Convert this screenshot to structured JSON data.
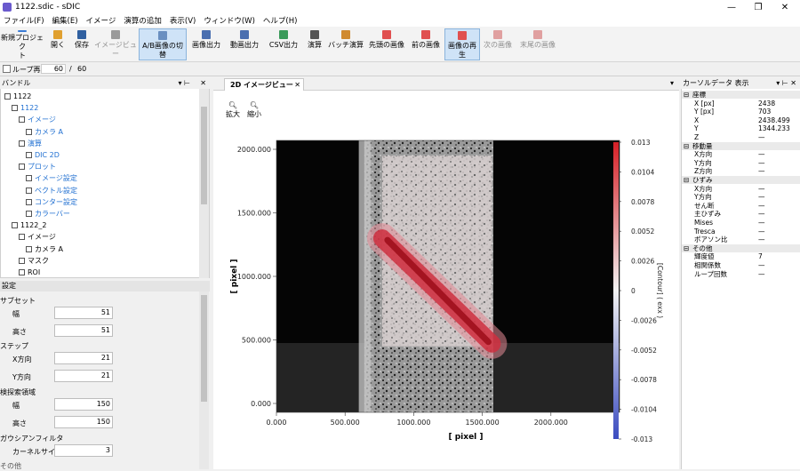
{
  "window": {
    "title": "1122.sdic - sDIC",
    "minimize": "—",
    "restore": "❐",
    "close": "✕"
  },
  "menu": [
    "ファイル(F)",
    "編集(E)",
    "イメージ",
    "演算の追加",
    "表示(V)",
    "ウィンドウ(W)",
    "ヘルプ(H)"
  ],
  "toolbar": [
    {
      "label": "新規プロジェク\nト",
      "icon": "new-file-icon",
      "state": "normal"
    },
    {
      "label": "開く",
      "icon": "open-folder-icon",
      "state": "normal"
    },
    {
      "label": "保存",
      "icon": "save-icon",
      "state": "normal"
    },
    {
      "label": "イメージビュー",
      "icon": "image-view-icon",
      "state": "disabled"
    },
    {
      "label": "A/B画像の切\n替",
      "icon": "switch-icon",
      "state": "selected"
    },
    {
      "label": "画像出力",
      "icon": "image-export-icon",
      "state": "normal"
    },
    {
      "label": "動画出力",
      "icon": "video-export-icon",
      "state": "normal"
    },
    {
      "label": "CSV出力",
      "icon": "csv-export-icon",
      "state": "normal"
    },
    {
      "label": "演算",
      "icon": "calculate-icon",
      "state": "normal"
    },
    {
      "label": "バッチ演算",
      "icon": "batch-icon",
      "state": "normal"
    },
    {
      "label": "先頭の画像",
      "icon": "first-image-icon",
      "state": "normal"
    },
    {
      "label": "前の画像",
      "icon": "previous-image-icon",
      "state": "normal"
    },
    {
      "label": "画像の再生",
      "icon": "play-icon",
      "state": "selected"
    },
    {
      "label": "次の画像",
      "icon": "next-image-icon",
      "state": "disabled"
    },
    {
      "label": "末尾の画像",
      "icon": "last-image-icon",
      "state": "disabled"
    }
  ],
  "loop": {
    "label": "ループ再",
    "current": "60",
    "sep": "/",
    "total": "60"
  },
  "bundle": {
    "title": "バンドル",
    "items": [
      {
        "label": "1122",
        "depth": 0,
        "blue": false
      },
      {
        "label": "1122",
        "depth": 1,
        "blue": true
      },
      {
        "label": "イメージ",
        "depth": 2,
        "blue": true
      },
      {
        "label": "カメラ A",
        "depth": 3,
        "blue": true
      },
      {
        "label": "演算",
        "depth": 2,
        "blue": true
      },
      {
        "label": "DIC 2D",
        "depth": 3,
        "blue": true
      },
      {
        "label": "プロット",
        "depth": 2,
        "blue": true
      },
      {
        "label": "イメージ設定",
        "depth": 3,
        "blue": true
      },
      {
        "label": "ベクトル設定",
        "depth": 3,
        "blue": true
      },
      {
        "label": "コンター設定",
        "depth": 3,
        "blue": true
      },
      {
        "label": "カラーバー",
        "depth": 3,
        "blue": true
      },
      {
        "label": "1122_2",
        "depth": 1,
        "blue": false
      },
      {
        "label": "イメージ",
        "depth": 2,
        "blue": false
      },
      {
        "label": "カメラ A",
        "depth": 3,
        "blue": false
      },
      {
        "label": "マスク",
        "depth": 2,
        "blue": false
      },
      {
        "label": "ROI",
        "depth": 2,
        "blue": false
      }
    ]
  },
  "settings": {
    "title": "設定",
    "subset": {
      "title": "サブセット",
      "width_label": "幅",
      "width": "51",
      "height_label": "高さ",
      "height": "51"
    },
    "step": {
      "title": "ステップ",
      "x_label": "X方向",
      "x": "21",
      "y_label": "Y方向",
      "y": "21"
    },
    "search": {
      "title": "検探索領域",
      "width_label": "幅",
      "width": "150",
      "height_label": "高さ",
      "height": "150"
    },
    "gauss": {
      "title": "ガウシアンフィルタ",
      "kernel_label": "カーネルサイズ",
      "kernel": "3"
    },
    "more": "その他"
  },
  "doc": {
    "tab": "2D イメージビュー",
    "zoom_in": "拡大",
    "zoom_out": "縮小",
    "xlabel": "[ pixel ]",
    "ylabel": "[ pixel ]",
    "colorbar_label": "[Contour] ( exx )"
  },
  "chart_data": {
    "type": "heatmap",
    "xlabel": "[ pixel ]",
    "ylabel": "[ pixel ]",
    "xlim": [
      0,
      2500
    ],
    "ylim": [
      -70,
      2070
    ],
    "xticks": [
      "0.000",
      "500.000",
      "1000.000",
      "1500.000",
      "2000.000"
    ],
    "xtick_values": [
      0,
      500,
      1000,
      1500,
      2000
    ],
    "yticks": [
      "0.000",
      "500.000",
      "1000.000",
      "1500.000",
      "2000.000"
    ],
    "ytick_values": [
      0,
      500,
      1000,
      1500,
      2000
    ],
    "colorbar": {
      "label": "[Contour] ( exx )",
      "min": -0.013,
      "max": 0.013,
      "ticks": [
        "0.013",
        "0.0104",
        "0.0078",
        "0.0052",
        "0.0026",
        "0",
        "-0.0026",
        "-0.0052",
        "-0.0078",
        "-0.0104",
        "-0.013"
      ],
      "tick_values": [
        0.013,
        0.0104,
        0.0078,
        0.0052,
        0.0026,
        0,
        -0.0026,
        -0.0052,
        -0.0078,
        -0.0104,
        -0.013
      ],
      "colors": {
        "high": "#d62027",
        "mid": "#f2f2f2",
        "low": "#3b4cc0"
      }
    },
    "roi": {
      "x": [
        770,
        1570
      ],
      "y": [
        450,
        1950
      ]
    },
    "shear_band": {
      "from": [
        770,
        1300
      ],
      "to": [
        1570,
        470
      ],
      "peak_value": 0.013
    }
  },
  "cursor_data": {
    "title": "カーソルデータ 表示",
    "sections": [
      {
        "name": "座標",
        "rows": [
          [
            "X [px]",
            "2438"
          ],
          [
            "Y [px]",
            "703"
          ],
          [
            "X",
            "2438.499"
          ],
          [
            "Y",
            "1344.233"
          ],
          [
            "Z",
            "—"
          ]
        ]
      },
      {
        "name": "移動量",
        "rows": [
          [
            "X方向",
            "—"
          ],
          [
            "Y方向",
            "—"
          ],
          [
            "Z方向",
            "—"
          ]
        ]
      },
      {
        "name": "ひずみ",
        "rows": [
          [
            "X方向",
            "—"
          ],
          [
            "Y方向",
            "—"
          ],
          [
            "せん断",
            "—"
          ],
          [
            "主ひずみ",
            "—"
          ],
          [
            "Mises",
            "—"
          ],
          [
            "Tresca",
            "—"
          ],
          [
            "ポアソン比",
            "—"
          ]
        ]
      },
      {
        "name": "その他",
        "rows": [
          [
            "輝度値",
            "7"
          ],
          [
            "相関係数",
            "—"
          ],
          [
            "ループ回数",
            "—"
          ]
        ]
      }
    ]
  },
  "colors": {
    "accent": "#1f6fd1",
    "selected_bg": "#cfe3f7"
  }
}
